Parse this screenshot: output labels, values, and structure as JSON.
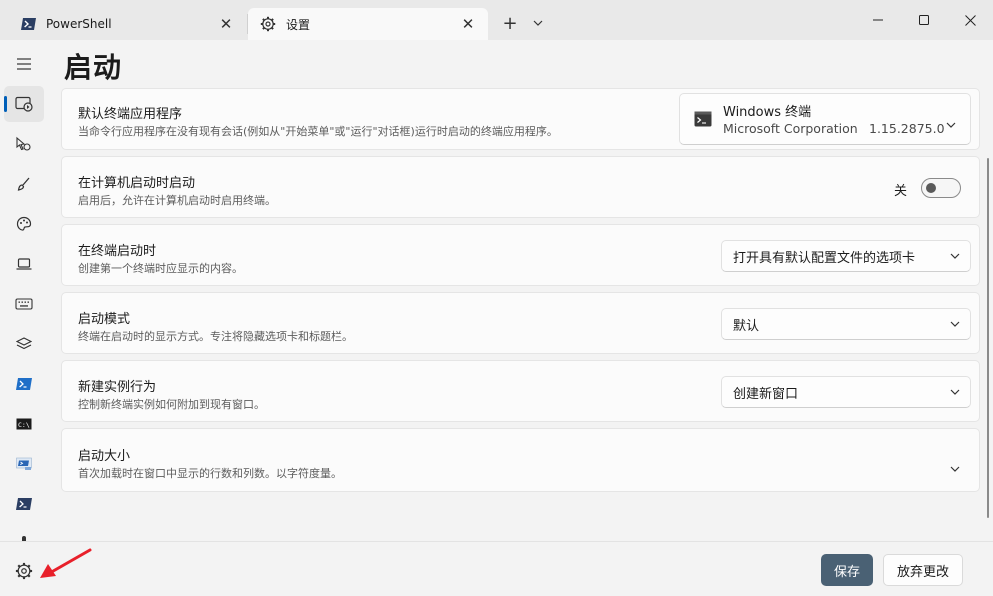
{
  "tabs": [
    {
      "label": "PowerShell",
      "icon": "powershell-icon",
      "active": false
    },
    {
      "label": "设置",
      "icon": "gear-icon",
      "active": true
    }
  ],
  "page": {
    "title": "启动"
  },
  "settings": {
    "default_terminal": {
      "title": "默认终端应用程序",
      "description": "当命令行应用程序在没有现有会话(例如从\"开始菜单\"或\"运行\"对话框)运行时启动的终端应用程序。",
      "selected_name": "Windows 终端",
      "selected_publisher": "Microsoft Corporation",
      "selected_version": "1.15.2875.0"
    },
    "launch_on_startup": {
      "title": "在计算机启动时启动",
      "description": "启用后，允许在计算机启动时启用终端。",
      "toggle_state_label": "关",
      "enabled": false
    },
    "on_launch": {
      "title": "在终端启动时",
      "description": "创建第一个终端时应显示的内容。",
      "value": "打开具有默认配置文件的选项卡"
    },
    "launch_mode": {
      "title": "启动模式",
      "description": "终端在启动时的显示方式。专注将隐藏选项卡和标题栏。",
      "value": "默认"
    },
    "new_instance": {
      "title": "新建实例行为",
      "description": "控制新终端实例如何附加到现有窗口。",
      "value": "创建新窗口"
    },
    "launch_size": {
      "title": "启动大小",
      "description": "首次加载时在窗口中显示的行数和列数。以字符度量。"
    }
  },
  "footer": {
    "save_label": "保存",
    "discard_label": "放弃更改"
  },
  "colors": {
    "accent": "#005fb8",
    "save_button": "#4a6174",
    "annotation_arrow": "#e8202a"
  }
}
